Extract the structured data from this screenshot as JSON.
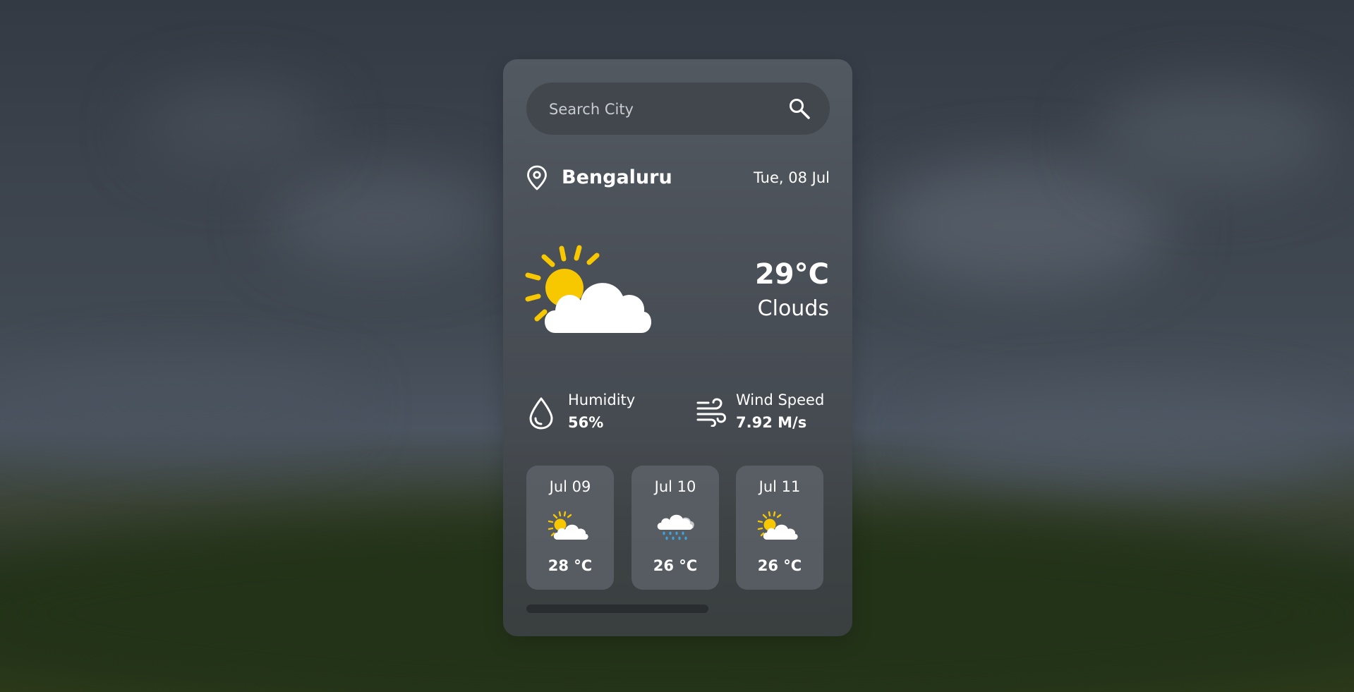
{
  "search": {
    "placeholder": "Search City",
    "icon": "search-icon"
  },
  "location": {
    "city": "Bengaluru",
    "date": "Tue, 08 Jul",
    "icon": "map-pin-icon"
  },
  "current": {
    "temperature": "29°C",
    "condition": "Clouds",
    "icon": "sun-behind-cloud-icon"
  },
  "stats": {
    "humidity": {
      "label": "Humidity",
      "value": "56%",
      "icon": "water-drop-icon"
    },
    "wind": {
      "label": "Wind Speed",
      "value": "7.92 M/s",
      "icon": "wind-icon"
    }
  },
  "forecast": [
    {
      "date": "Jul 09",
      "temp": "28 °C",
      "icon": "sun-behind-cloud-icon"
    },
    {
      "date": "Jul 10",
      "temp": "26 °C",
      "icon": "rain-cloud-icon"
    },
    {
      "date": "Jul 11",
      "temp": "26 °C",
      "icon": "sun-behind-cloud-icon"
    }
  ],
  "scrollbar": {
    "position_fraction": 0.6
  },
  "colors": {
    "sun": "#F7C700",
    "cloud": "#FFFFFF",
    "rain": "#3FA3E0",
    "text": "#FFFFFF"
  }
}
